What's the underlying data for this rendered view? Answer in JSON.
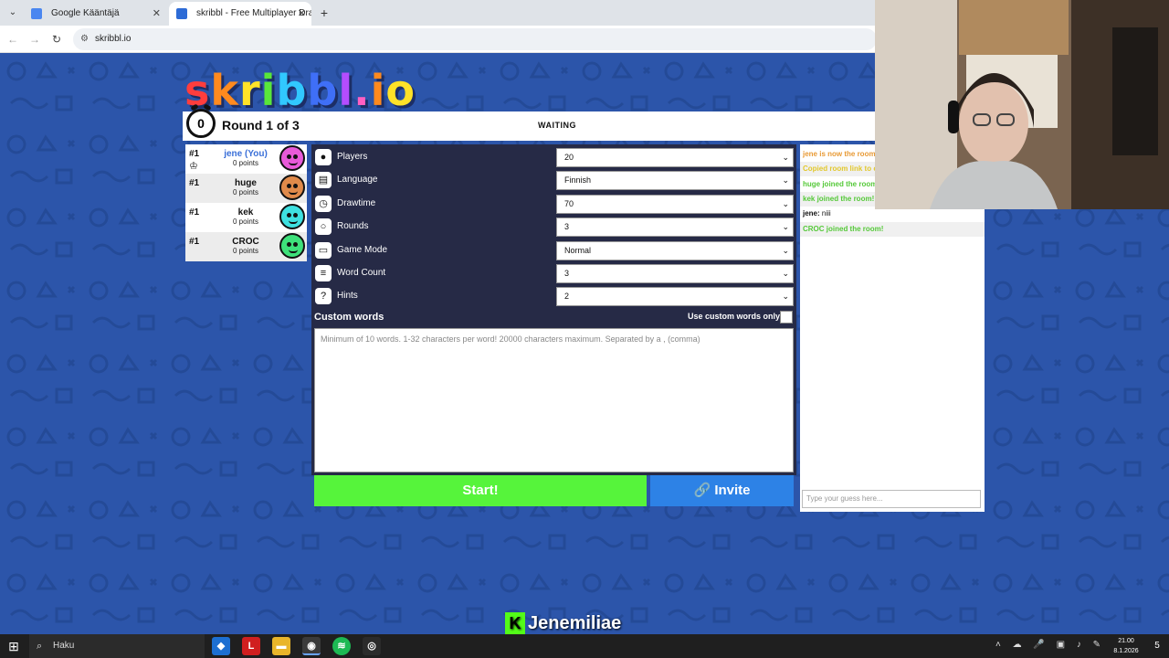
{
  "browser": {
    "tabs": [
      {
        "title": "Google Kääntäjä",
        "active": false
      },
      {
        "title": "skribbl - Free Multiplayer Drawi",
        "active": true
      }
    ],
    "url": "skribbl.io"
  },
  "game": {
    "logo_parts": [
      "s",
      "k",
      "r",
      "i",
      "b",
      "b",
      "l",
      ".",
      "i",
      "o"
    ],
    "logo_colors": [
      "#ff3d3d",
      "#ff8a1f",
      "#ffe228",
      "#59e63a",
      "#31c8ff",
      "#3f6ff7",
      "#b44dff",
      "#ff5fc2",
      "#ff8a1f",
      "#ffe228"
    ],
    "timer": "0",
    "round_label": "Round 1 of 3",
    "status": "WAITING",
    "players": [
      {
        "rank": "#1",
        "name": "jene (You)",
        "points": "0 points",
        "is_you": true,
        "color": "#e85ad8"
      },
      {
        "rank": "#1",
        "name": "huge",
        "points": "0 points",
        "is_you": false,
        "color": "#e08a4a"
      },
      {
        "rank": "#1",
        "name": "kek",
        "points": "0 points",
        "is_you": false,
        "color": "#3ee0e0"
      },
      {
        "rank": "#1",
        "name": "CROC",
        "points": "0 points",
        "is_you": false,
        "color": "#3ee07a"
      }
    ],
    "settings": [
      {
        "label": "Players",
        "value": "20",
        "icon": "person-icon"
      },
      {
        "label": "Language",
        "value": "Finnish",
        "icon": "book-icon"
      },
      {
        "label": "Drawtime",
        "value": "70",
        "icon": "alarm-icon"
      },
      {
        "label": "Rounds",
        "value": "3",
        "icon": "ring-icon"
      },
      {
        "label": "Game Mode",
        "value": "Normal",
        "icon": "gamepad-icon"
      },
      {
        "label": "Word Count",
        "value": "3",
        "icon": "list-icon"
      },
      {
        "label": "Hints",
        "value": "2",
        "icon": "question-icon"
      }
    ],
    "custom_words_title": "Custom words",
    "custom_words_only_label": "Use custom words only",
    "custom_words_placeholder": "Minimum of 10 words. 1-32 characters per word! 20000 characters maximum. Separated by a , (comma)",
    "start_label": "Start!",
    "invite_label": "Invite"
  },
  "chat": {
    "messages": [
      {
        "type": "orange",
        "text": "jene is now the room owner!"
      },
      {
        "type": "yellow",
        "text": "Copied room link to clipboard!"
      },
      {
        "type": "green",
        "text": "huge joined the room!"
      },
      {
        "type": "green",
        "text": "kek joined the room!"
      },
      {
        "type": "user",
        "who": "jene:",
        "text": "niii"
      },
      {
        "type": "green",
        "text": "CROC joined the room!"
      }
    ],
    "input_placeholder": "Type your guess here..."
  },
  "streamer_name": "Jenemiliae",
  "taskbar": {
    "search_label": "Haku",
    "time": "21.00",
    "date": "8.1.2026",
    "notification_count": "5"
  }
}
